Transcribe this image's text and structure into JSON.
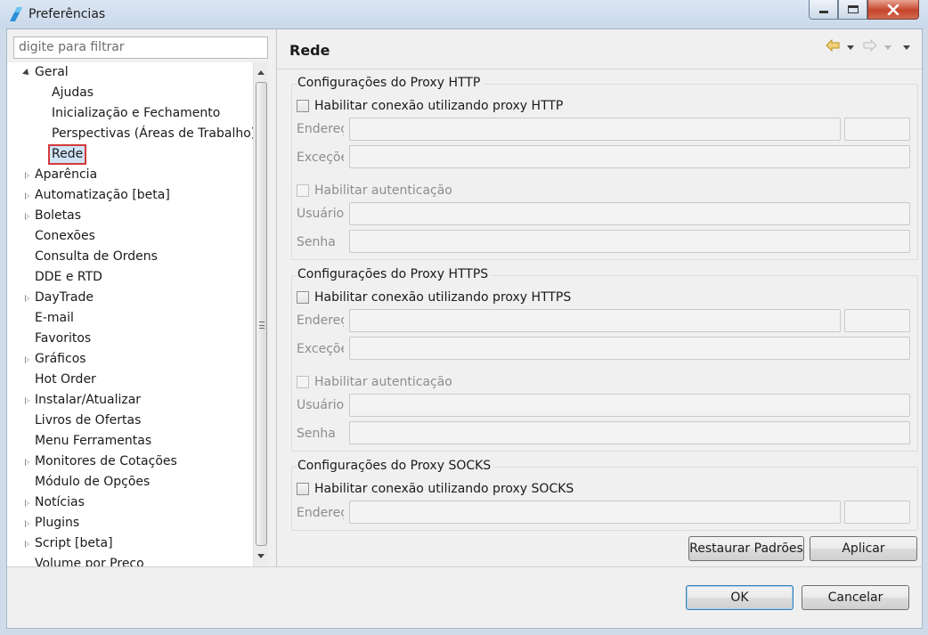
{
  "window": {
    "title": "Preferências"
  },
  "filter": {
    "placeholder": "digite para filtrar"
  },
  "tree": {
    "items": [
      {
        "label": "Geral",
        "state": "open",
        "level": 0
      },
      {
        "label": "Ajudas",
        "state": "leaf",
        "level": 1
      },
      {
        "label": "Inicialização e Fechamento",
        "state": "leaf",
        "level": 1
      },
      {
        "label": "Perspectivas (Áreas de Trabalho)",
        "state": "leaf",
        "level": 1
      },
      {
        "label": "Rede",
        "state": "leaf",
        "level": 1,
        "selected": true
      },
      {
        "label": "Aparência",
        "state": "closed",
        "level": 0
      },
      {
        "label": "Automatização [beta]",
        "state": "closed",
        "level": 0
      },
      {
        "label": "Boletas",
        "state": "closed",
        "level": 0
      },
      {
        "label": "Conexões",
        "state": "leaf",
        "level": 0
      },
      {
        "label": "Consulta de Ordens",
        "state": "leaf",
        "level": 0
      },
      {
        "label": "DDE e RTD",
        "state": "leaf",
        "level": 0
      },
      {
        "label": "DayTrade",
        "state": "closed",
        "level": 0
      },
      {
        "label": "E-mail",
        "state": "leaf",
        "level": 0
      },
      {
        "label": "Favoritos",
        "state": "leaf",
        "level": 0
      },
      {
        "label": "Gráficos",
        "state": "closed",
        "level": 0
      },
      {
        "label": "Hot Order",
        "state": "leaf",
        "level": 0
      },
      {
        "label": "Instalar/Atualizar",
        "state": "closed",
        "level": 0
      },
      {
        "label": "Livros de Ofertas",
        "state": "leaf",
        "level": 0
      },
      {
        "label": "Menu Ferramentas",
        "state": "leaf",
        "level": 0
      },
      {
        "label": "Monitores de Cotações",
        "state": "closed",
        "level": 0
      },
      {
        "label": "Módulo de Opções",
        "state": "leaf",
        "level": 0
      },
      {
        "label": "Notícias",
        "state": "closed",
        "level": 0
      },
      {
        "label": "Plugins",
        "state": "closed",
        "level": 0
      },
      {
        "label": "Script [beta]",
        "state": "closed",
        "level": 0
      },
      {
        "label": "Volume por Preço",
        "state": "leaf",
        "level": 0
      }
    ]
  },
  "panel": {
    "title": "Rede",
    "http": {
      "group_label": "Configurações do Proxy HTTP",
      "enable_label": "Habilitar conexão utilizando proxy HTTP",
      "address_label": "Endereço",
      "exceptions_label": "Exceções",
      "auth_label": "Habilitar autenticação",
      "user_label": "Usuário",
      "password_label": "Senha"
    },
    "https": {
      "group_label": "Configurações do Proxy HTTPS",
      "enable_label": "Habilitar conexão utilizando proxy HTTPS",
      "address_label": "Endereço",
      "exceptions_label": "Exceções",
      "auth_label": "Habilitar autenticação",
      "user_label": "Usuário",
      "password_label": "Senha"
    },
    "socks": {
      "group_label": "Configurações do Proxy SOCKS",
      "enable_label": "Habilitar conexão utilizando proxy SOCKS",
      "address_label": "Endereço"
    },
    "restore_label": "Restaurar Padrões",
    "apply_label": "Aplicar"
  },
  "dialog": {
    "ok_label": "OK",
    "cancel_label": "Cancelar"
  }
}
